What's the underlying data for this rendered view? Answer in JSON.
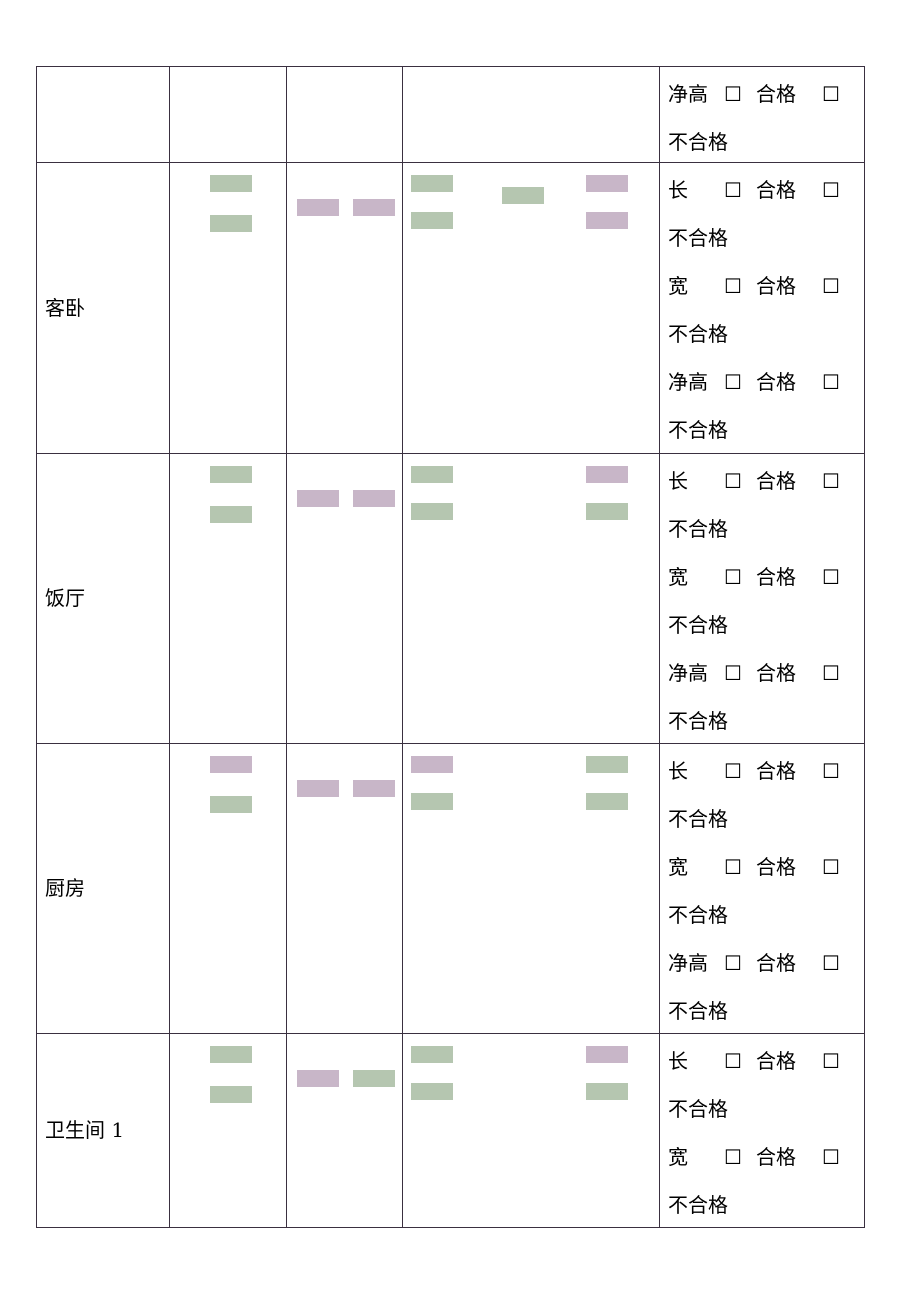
{
  "box_symbol": "☐",
  "pass_label": "合格",
  "fail_label": "不合格",
  "colors": {
    "green_mask": "#b5c6b0",
    "purple_mask": "#c8b6c8",
    "border": "#3a3040"
  },
  "rows": [
    {
      "room": "",
      "checks": [
        "净高"
      ]
    },
    {
      "room": "客卧",
      "checks": [
        "长",
        "宽",
        "净高"
      ]
    },
    {
      "room": "饭厅",
      "checks": [
        "长",
        "宽",
        "净高"
      ]
    },
    {
      "room": "厨房",
      "checks": [
        "长",
        "宽",
        "净高"
      ]
    },
    {
      "room": "卫生间 1",
      "checks": [
        "长",
        "宽"
      ]
    }
  ]
}
